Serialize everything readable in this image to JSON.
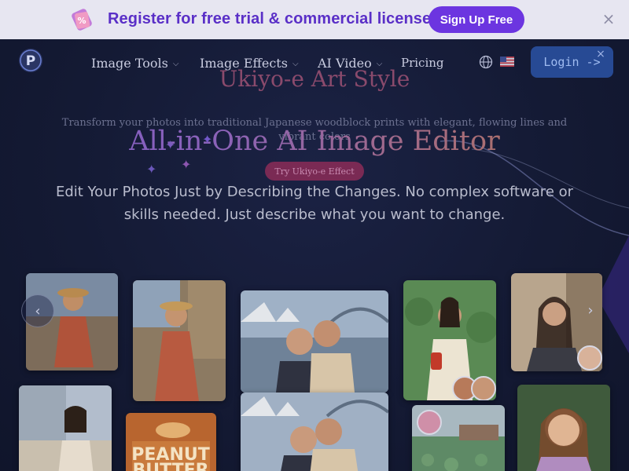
{
  "promo": {
    "icon": "tag-icon",
    "text": "Register for free trial & commercial license",
    "signup_label": "Sign Up Free",
    "close_icon": "×"
  },
  "nav": {
    "logo": "P",
    "items": [
      {
        "label": "Image Tools",
        "has_dropdown": true
      },
      {
        "label": "Image Effects",
        "has_dropdown": true
      },
      {
        "label": "AI Video",
        "has_dropdown": true
      },
      {
        "label": "Pricing",
        "has_dropdown": false
      }
    ],
    "chevron": "⌵",
    "globe_icon": "globe-icon",
    "flag_icon": "us-flag-icon",
    "login_label": "Login ->",
    "login_close": "×"
  },
  "carousel_behind": {
    "title": "Ukiyo-e Art Style",
    "description": "Transform your photos into traditional Japanese woodblock prints with elegant, flowing lines and vibrant colors",
    "button_label": "Try Ukiyo-e Effect"
  },
  "hero": {
    "title": "All-in-One AI Image Editor",
    "subtitle": "Edit Your Photos Just by Describing the Changes. No complex software or skills needed. Just describe what you want to change."
  },
  "gallery": {
    "prev_label": "‹",
    "next_label": "›",
    "food_label_top": "PEANUT",
    "food_label_bottom": "BUTTER"
  },
  "colors": {
    "banner_bg": "#e7e6f1",
    "banner_text": "#5a2fc7",
    "signup_bg": "#6c35e0",
    "page_bg": "#151a33",
    "login_bg": "#274a94",
    "ghost_button": "#7a2a54"
  }
}
